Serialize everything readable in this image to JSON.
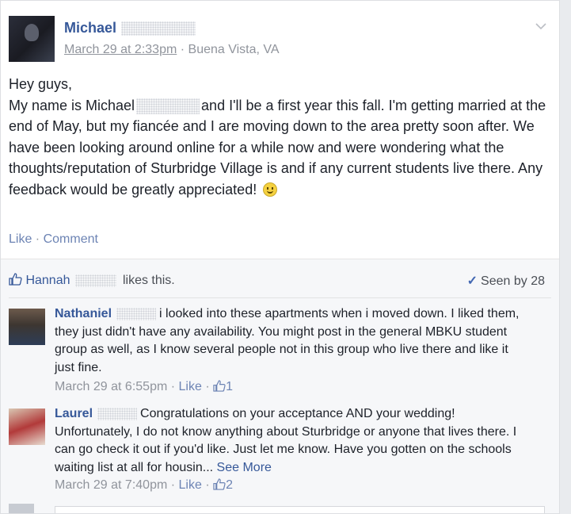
{
  "post": {
    "author": "Michael",
    "time": "March 29 at 2:33pm",
    "separator": " · ",
    "location": "Buena Vista, VA",
    "menu_icon": "chevron-down-icon",
    "text_line1": "Hey guys,",
    "text_part1": "My name is Michael",
    "text_part2": "and I'll be a first year this fall. I'm getting married at the end of May, but my fiancée and I are moving down to the area pretty soon after. We have been looking around online for a while now and were wondering what the thoughts/reputation of Sturbridge Village is and if any current students live there. Any feedback would be greatly appreciated!",
    "emoji": "smiley-icon",
    "actions": {
      "like": "Like",
      "sep": " · ",
      "comment": "Comment"
    }
  },
  "feedback": {
    "liker": "Hannah",
    "likes_text": "likes this.",
    "seen_label": "Seen by 28"
  },
  "comments": [
    {
      "author": "Nathaniel",
      "text": "i looked into these apartments when i moved down. I liked them, they just didn't have any availability. You might post in the general MBKU student group as well, as I know several people not in this group who live there and like it just fine.",
      "time": "March 29 at 6:55pm",
      "like": "Like",
      "like_count": "1"
    },
    {
      "author": "Laurel",
      "text": "Congratulations on your acceptance AND your wedding! Unfortunately, I do not know anything about Sturbridge or anyone that lives there. I can go check it out if you'd like. Just let me know. Have you gotten on the schools waiting list at all for housin...",
      "see_more": "See More",
      "time": "March 29 at 7:40pm",
      "like": "Like",
      "like_count": "2"
    }
  ],
  "colors": {
    "link": "#365899",
    "meta": "#90949c",
    "background": "#e9ebee"
  }
}
